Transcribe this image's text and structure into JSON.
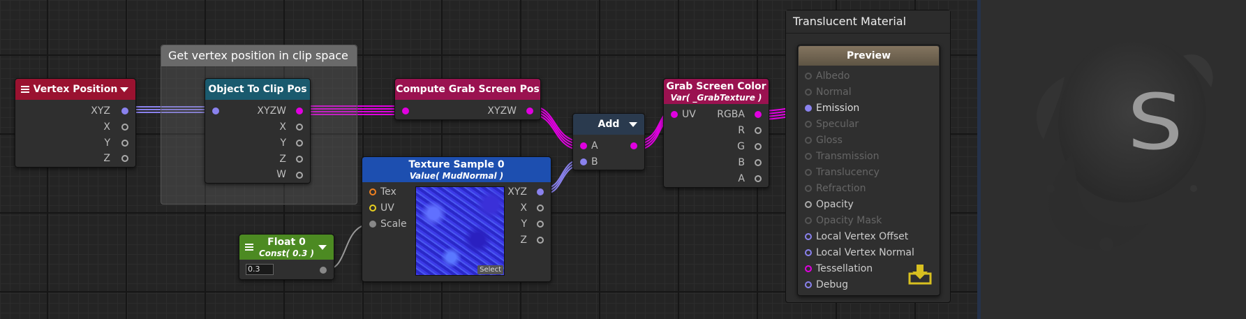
{
  "colors": {
    "canvas": "#242424",
    "port_vec4": "#e000e0",
    "port_vec3": "#8a82ee",
    "port_scalar": "#aaaaaa",
    "port_tex": "#f08020",
    "port_uv": "#e8d020"
  },
  "groups": [
    {
      "title": "Get vertex position in clip space"
    }
  ],
  "nodes": {
    "vertex_position": {
      "title": "Vertex Position",
      "icons": [
        "menu-icon",
        "dropdown-arrow-icon"
      ],
      "outputs": [
        "XYZ",
        "X",
        "Y",
        "Z"
      ]
    },
    "object_to_clip": {
      "title": "Object To Clip Pos",
      "outputs": [
        "XYZW",
        "X",
        "Y",
        "Z",
        "W"
      ]
    },
    "compute_grab": {
      "title": "Compute Grab Screen Pos",
      "outputs": [
        "XYZW"
      ]
    },
    "add": {
      "title": "Add",
      "inputs": [
        "A",
        "B"
      ],
      "icons": [
        "dropdown-arrow-icon"
      ]
    },
    "grab_color": {
      "title": "Grab Screen Color",
      "subtitle": "Var( _GrabTexture )",
      "inputs": [
        "UV"
      ],
      "outputs": [
        "RGBA",
        "R",
        "G",
        "B",
        "A"
      ]
    },
    "texture_sample": {
      "title": "Texture Sample 0",
      "subtitle": "Value( MudNormal )",
      "inputs": [
        "Tex",
        "UV",
        "Scale"
      ],
      "outputs": [
        "XYZ",
        "X",
        "Y",
        "Z"
      ],
      "select_label": "Select"
    },
    "float0": {
      "title": "Float 0",
      "subtitle": "Const( 0.3 )",
      "value": "0.3",
      "icons": [
        "menu-icon",
        "dropdown-arrow-icon"
      ]
    }
  },
  "master": {
    "title": "Translucent Material",
    "preview_label": "Preview",
    "inputs": [
      {
        "label": "Albedo",
        "connected": false
      },
      {
        "label": "Normal",
        "connected": false
      },
      {
        "label": "Emission",
        "connected": true
      },
      {
        "label": "Specular",
        "connected": false
      },
      {
        "label": "Gloss",
        "connected": false
      },
      {
        "label": "Transmission",
        "connected": false
      },
      {
        "label": "Translucency",
        "connected": false
      },
      {
        "label": "Refraction",
        "connected": false
      },
      {
        "label": "Opacity",
        "connected": false
      },
      {
        "label": "Opacity Mask",
        "connected": false
      },
      {
        "label": "Local Vertex Offset",
        "connected": false
      },
      {
        "label": "Local Vertex Normal",
        "connected": false
      },
      {
        "label": "Tessellation",
        "connected": false
      },
      {
        "label": "Debug",
        "connected": false
      }
    ],
    "save_icon": "download-icon"
  },
  "side_panel": {
    "logo_letter": "S",
    "logo_icon": "ink-splash-logo"
  }
}
